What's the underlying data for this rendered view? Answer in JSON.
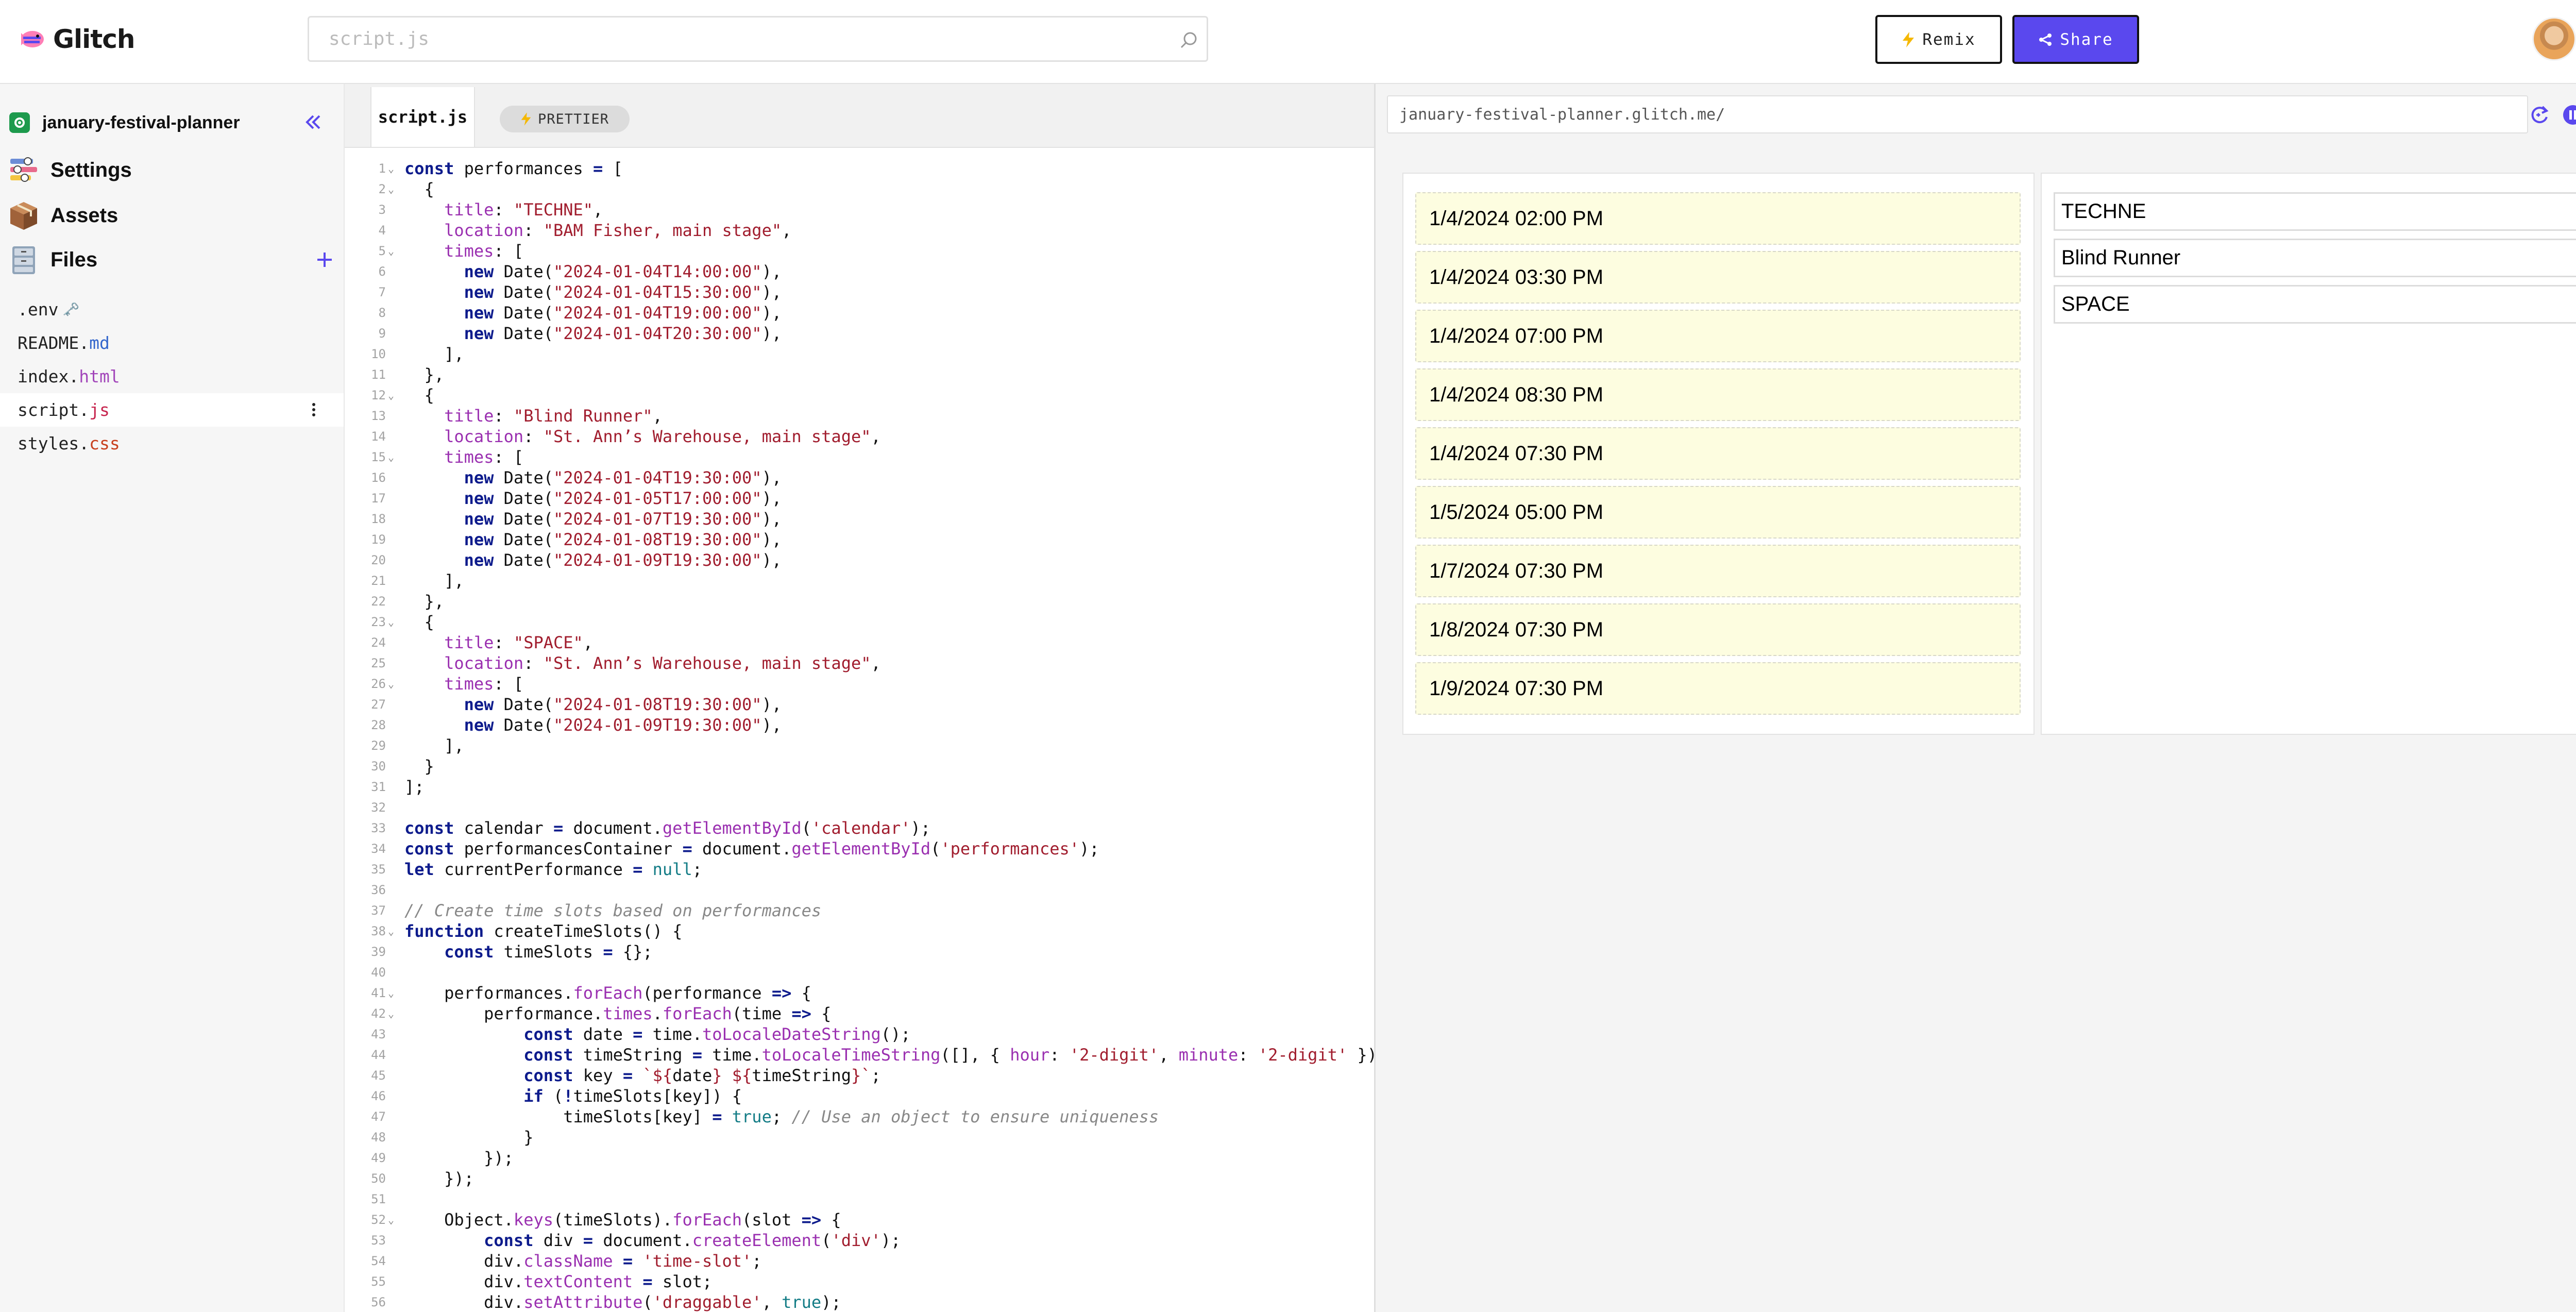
{
  "app": {
    "logo_text": "Glitch",
    "search_placeholder": "script.js",
    "remix_label": "Remix",
    "share_label": "Share",
    "accent_color": "#5a48ee"
  },
  "sidebar": {
    "project_name": "january-festival-planner",
    "nav": {
      "settings": "Settings",
      "assets": "Assets",
      "files": "Files"
    },
    "files": [
      {
        "base": ".env",
        "ext": "",
        "suffix": "🗝️"
      },
      {
        "base": "README.",
        "ext": "md",
        "suffix": ""
      },
      {
        "base": "index.",
        "ext": "html",
        "suffix": ""
      },
      {
        "base": "script.",
        "ext": "js",
        "suffix": ""
      },
      {
        "base": "styles.",
        "ext": "css",
        "suffix": ""
      }
    ],
    "active_file": "script.js"
  },
  "editor": {
    "tab_label": "script.js",
    "prettier_label": "PRETTIER"
  },
  "preview": {
    "url": "january-festival-planner.glitch.me/",
    "time_slots": [
      "1/4/2024 02:00 PM",
      "1/4/2024 03:30 PM",
      "1/4/2024 07:00 PM",
      "1/4/2024 08:30 PM",
      "1/4/2024 07:30 PM",
      "1/5/2024 05:00 PM",
      "1/7/2024 07:30 PM",
      "1/8/2024 07:30 PM",
      "1/9/2024 07:30 PM"
    ],
    "performances": [
      "TECHNE",
      "Blind Runner",
      "SPACE"
    ]
  }
}
